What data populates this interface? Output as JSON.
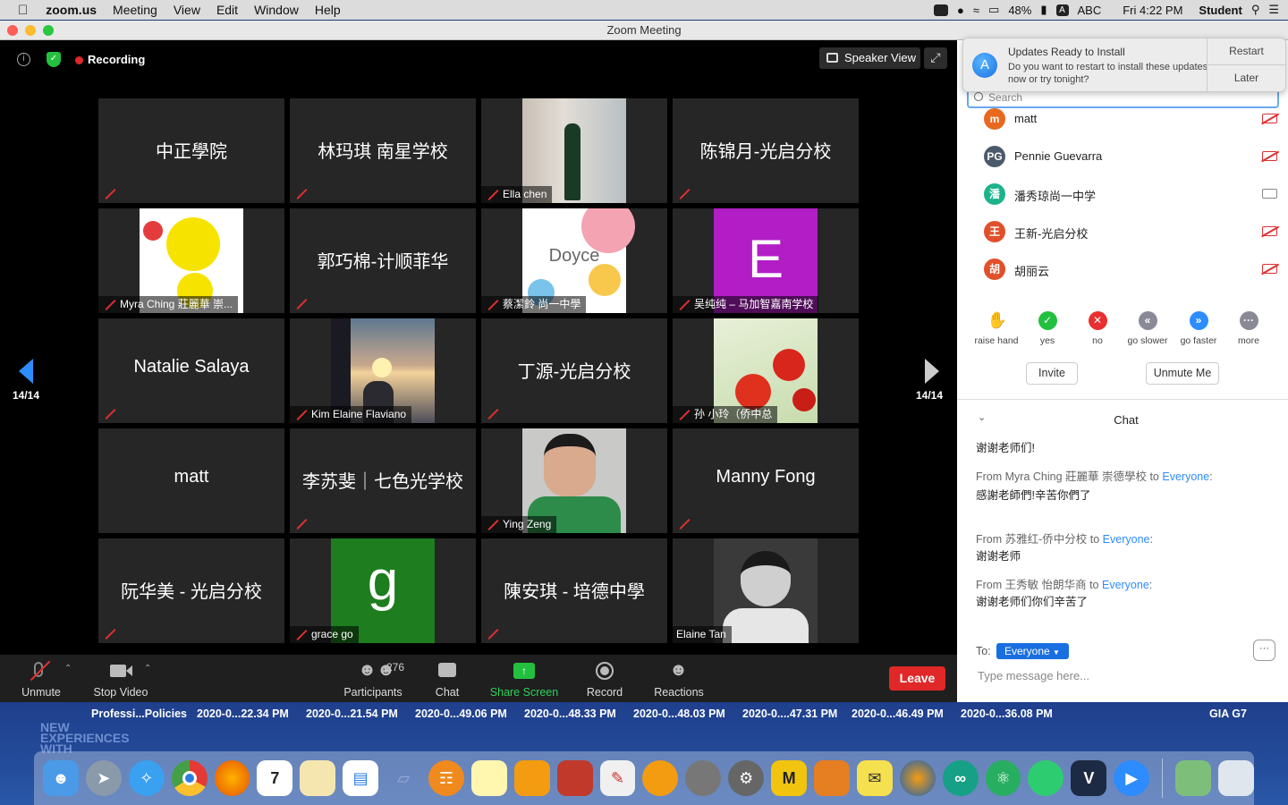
{
  "menubar": {
    "app": "zoom.us",
    "items": [
      "Meeting",
      "View",
      "Edit",
      "Window",
      "Help"
    ],
    "battery": "48%",
    "input": "ABC",
    "clock": "Fri 4:22 PM",
    "user": "Student"
  },
  "window": {
    "title": "Zoom Meeting"
  },
  "topbar": {
    "recording": "Recording",
    "speaker_view": "Speaker View"
  },
  "page_indicator": {
    "left": "14/14",
    "right": "14/14"
  },
  "tiles": [
    {
      "name": "中正學院",
      "type": "name"
    },
    {
      "name": "林玛琪 南星学校",
      "type": "name"
    },
    {
      "name": "Ella chen",
      "type": "video"
    },
    {
      "name": "陈锦月-光启分校",
      "type": "name"
    },
    {
      "name": "Myra Ching 莊麗華 崇...",
      "type": "video"
    },
    {
      "name": "郭巧棉-计顺菲华",
      "type": "name"
    },
    {
      "name": "蔡潔鈴 尚一中學",
      "type": "video",
      "image_text": "Doyce"
    },
    {
      "name": "吴纯纯 – 马加智嘉南学校",
      "type": "video",
      "image_text": "E"
    },
    {
      "name": "Natalie Salaya",
      "type": "name"
    },
    {
      "name": "Kim Elaine Flaviano",
      "type": "video"
    },
    {
      "name": "丁源-光启分校",
      "type": "name"
    },
    {
      "name": "孙 小玲（侨中总",
      "type": "video"
    },
    {
      "name": "matt",
      "type": "name"
    },
    {
      "name": "李苏斐｜七色光学校",
      "type": "name"
    },
    {
      "name": "Ying Zeng",
      "type": "video"
    },
    {
      "name": "Manny Fong",
      "type": "name"
    },
    {
      "name": "阮华美 - 光启分校",
      "type": "name"
    },
    {
      "name": "grace go",
      "type": "video",
      "image_text": "g"
    },
    {
      "name": "陳安琪 - 培德中學",
      "type": "name"
    },
    {
      "name": "Elaine Tan",
      "type": "video"
    }
  ],
  "toolbar": {
    "unmute": "Unmute",
    "stop_video": "Stop Video",
    "participants": "Participants",
    "participant_count": "276",
    "chat": "Chat",
    "share_screen": "Share Screen",
    "record": "Record",
    "reactions": "Reactions",
    "leave": "Leave"
  },
  "notification": {
    "title": "Updates Ready to Install",
    "body": "Do you want to restart to install these updates now or try tonight?",
    "restart": "Restart",
    "later": "Later"
  },
  "participants_panel": {
    "search_placeholder": "Search",
    "rows": [
      {
        "initial": "m",
        "name": "matt",
        "color": "#e8691e",
        "video_off": true
      },
      {
        "initial": "PG",
        "name": "Pennie Guevarra",
        "color": "#4a5a6a",
        "video_off": true
      },
      {
        "initial": "潘",
        "name": "潘秀琼尚一中学",
        "color": "#1db38a",
        "video_off": false
      },
      {
        "initial": "王",
        "name": "王新-光启分校",
        "color": "#e0502a",
        "video_off": true
      },
      {
        "initial": "胡",
        "name": "胡丽云",
        "color": "#e0502a",
        "video_off": true
      }
    ],
    "feedback": [
      "raise hand",
      "yes",
      "no",
      "go slower",
      "go faster",
      "more"
    ],
    "invite": "Invite",
    "unmute_me": "Unmute Me"
  },
  "chat": {
    "title": "Chat",
    "messages": [
      {
        "from": "",
        "text": "谢谢老师们!"
      },
      {
        "from": "From Myra Ching 莊麗華 崇德學校 to ",
        "to": "Everyone",
        "text": "感謝老師們!辛苦你們了"
      },
      {
        "from": "From 苏雅红-侨中分校 to ",
        "to": "Everyone",
        "text": "谢谢老师"
      },
      {
        "from": "From 王秀敏 怡朗华商 to ",
        "to": "Everyone",
        "text": "谢谢老师们你们辛苦了"
      }
    ],
    "to_label": "To:",
    "recipient": "Everyone",
    "placeholder": "Type message here..."
  },
  "desktop_labels": [
    "Professi...Policies",
    "2020-0...22.34 PM",
    "2020-0...21.54 PM",
    "2020-0...49.06 PM",
    "2020-0...48.33 PM",
    "2020-0...48.03 PM",
    "2020-0....47.31 PM",
    "2020-0...46.49 PM",
    "2020-0...36.08 PM",
    "GIA G7"
  ],
  "desktop_wallpaper_text": "NEW EXPERIENCES WITH"
}
